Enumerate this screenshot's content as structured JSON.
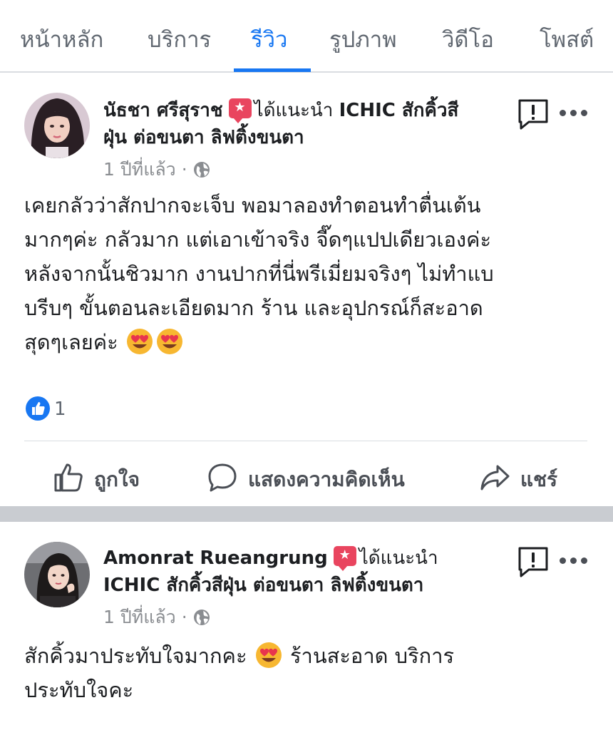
{
  "tabs": [
    {
      "label": "หน้าหลัก",
      "active": false
    },
    {
      "label": "บริการ",
      "active": false
    },
    {
      "label": "รีวิว",
      "active": true
    },
    {
      "label": "รูปภาพ",
      "active": false
    },
    {
      "label": "วิดีโอ",
      "active": false
    },
    {
      "label": "โพสต์",
      "active": false
    }
  ],
  "accent_color": "#1877f2",
  "recommend_badge_color": "#e9455f",
  "posts": [
    {
      "author": "นัธชา ศรีสุราช",
      "recommended_text": "ได้แนะนำ",
      "page_name": "ICHIC สักคิ้วสีฝุ่น ต่อขนตา ลิฟติ้งขนตา",
      "time": "1 ปีที่แล้ว",
      "separator": "·",
      "privacy_icon": "globe-icon",
      "body": "เคยกลัวว่าสักปากจะเจ็บ พอมาลองทำตอนทำตื่นเต้น\nมากๆค่ะ กลัวมาก แต่เอาเข้าจริง จี๊ดๆแปปเดียวเองค่ะ\nหลังจากนั้นชิวมาก งานปากที่นี่พรีเมี่ยมจริงๆ ไม่ทำแบ\nบรีบๆ ขั้นตอนละเอียดมาก ร้าน และอุปกรณ์ก็สะอาด\nสุดๆเลยค่ะ",
      "emojis": [
        "heart-eyes-emoji",
        "heart-eyes-emoji"
      ],
      "like_count": "1",
      "actions": {
        "like": "ถูกใจ",
        "comment": "แสดงความคิดเห็น",
        "share": "แชร์"
      }
    },
    {
      "author": "Amonrat Rueangrung",
      "recommended_text": "ได้แนะนำ",
      "page_name": "ICHIC สักคิ้วสีฝุ่น ต่อขนตา ลิฟติ้งขนตา",
      "time": "1 ปีที่แล้ว",
      "separator": "·",
      "privacy_icon": "globe-icon",
      "body_part1": "สักคิ้วมาประทับใจมากคะ",
      "body_part2": "ร้านสะอาด บริการ\nประทับใจคะ",
      "emojis": [
        "heart-eyes-emoji"
      ]
    }
  ]
}
